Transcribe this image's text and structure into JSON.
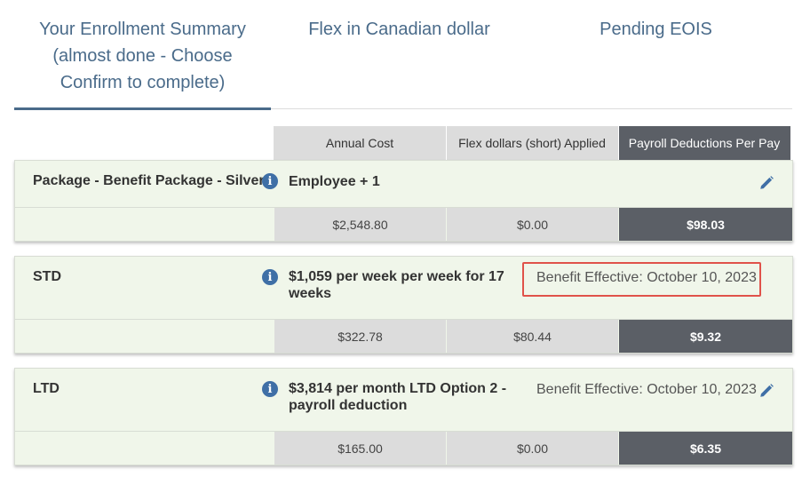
{
  "tabs": [
    {
      "label": "Your Enrollment Summary (almost done - Choose Confirm to complete)",
      "active": true
    },
    {
      "label": "Flex in Canadian dollar"
    },
    {
      "label": "Pending EOIS"
    }
  ],
  "columns": {
    "annual_cost": "Annual Cost",
    "flex_applied": "Flex dollars (short) Applied",
    "payroll": "Payroll Deductions Per Pay"
  },
  "benefits": [
    {
      "name": "Package - Benefit Package - Silver",
      "description": "Employee + 1",
      "effective": "",
      "annual_cost": "$2,548.80",
      "flex_applied": "$0.00",
      "payroll": "$98.03"
    },
    {
      "name": "STD",
      "description": "$1,059 per week per week for 17 weeks",
      "effective": "Benefit Effective: October 10, 2023",
      "annual_cost": "$322.78",
      "flex_applied": "$80.44",
      "payroll": "$9.32"
    },
    {
      "name": "LTD",
      "description": "$3,814 per month LTD Option 2 - payroll deduction",
      "effective": "Benefit Effective: October 10, 2023",
      "annual_cost": "$165.00",
      "flex_applied": "$0.00",
      "payroll": "$6.35"
    }
  ],
  "colors": {
    "accent": "#4a6b8a",
    "highlight": "#e0524a",
    "card_bg": "#f0f6ea",
    "dark_cell": "#5b5f66"
  }
}
